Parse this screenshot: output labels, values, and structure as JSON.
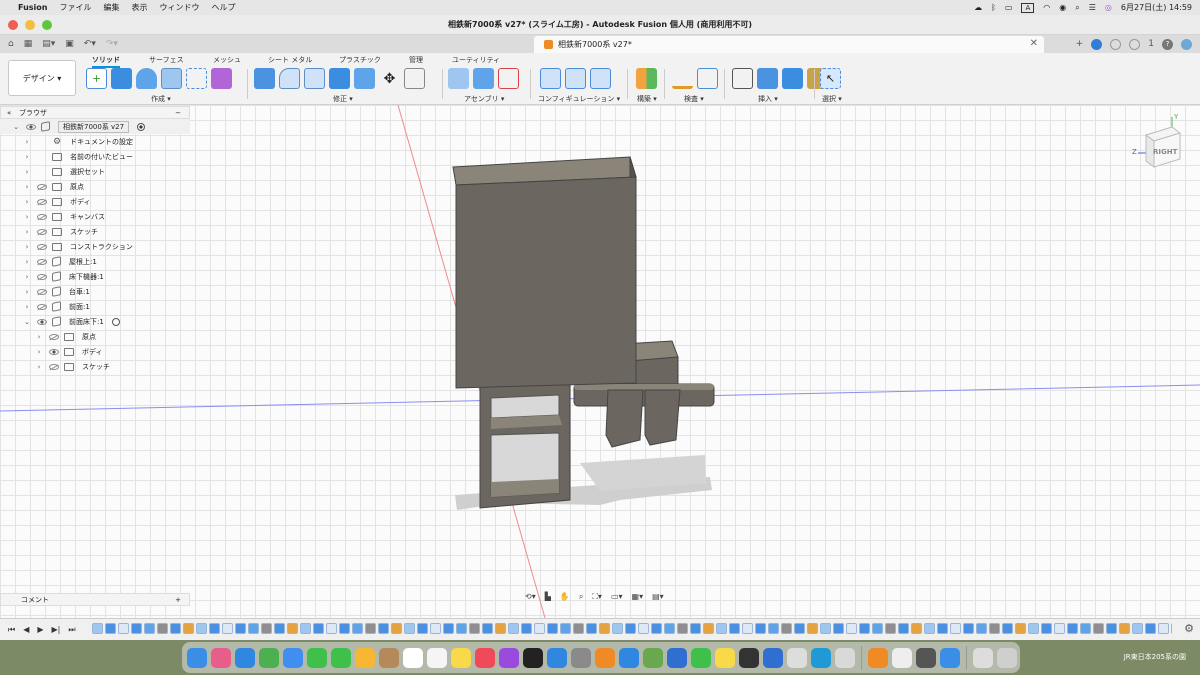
{
  "menubar": {
    "app_name": "Fusion",
    "items": [
      "ファイル",
      "編集",
      "表示",
      "ウィンドウ",
      "ヘルプ"
    ],
    "datetime": "6月27日(土) 14:59",
    "input_indicator": "A"
  },
  "window": {
    "title": "相鉄新7000系 v27* (スライム工房) - Autodesk Fusion 個人用 (商用利用不可)"
  },
  "document_tab": {
    "label": "相鉄新7000系 v27*",
    "close": "✕",
    "notifications": "1"
  },
  "toolbar": {
    "workspace": "デザイン ▾",
    "tabs": [
      "ソリッド",
      "サーフェス",
      "メッシュ",
      "シート メタル",
      "プラスチック",
      "管理",
      "ユーティリティ"
    ],
    "active_tab": "ソリッド",
    "groups": [
      {
        "label": "作成 ▾"
      },
      {
        "label": "修正 ▾"
      },
      {
        "label": "アセンブリ ▾"
      },
      {
        "label": "コンフィギュレーション ▾"
      },
      {
        "label": "構築 ▾"
      },
      {
        "label": "検査 ▾"
      },
      {
        "label": "挿入 ▾"
      },
      {
        "label": "選択 ▾"
      }
    ]
  },
  "browser": {
    "title": "ブラウザ",
    "rows": [
      {
        "label": "相鉄新7000系 v27",
        "expanded": true,
        "eye": "on",
        "icon": "doc",
        "indent": 0,
        "radio": true
      },
      {
        "label": "ドキュメントの設定",
        "expanded": false,
        "eye": "",
        "icon": "gear",
        "indent": 1
      },
      {
        "label": "名前の付いたビュー",
        "expanded": false,
        "eye": "",
        "icon": "folder",
        "indent": 1
      },
      {
        "label": "選択セット",
        "expanded": false,
        "eye": "",
        "icon": "folder",
        "indent": 1
      },
      {
        "label": "原点",
        "expanded": false,
        "eye": "off",
        "icon": "folder",
        "indent": 1
      },
      {
        "label": "ボディ",
        "expanded": false,
        "eye": "off",
        "icon": "folder",
        "indent": 1
      },
      {
        "label": "キャンバス",
        "expanded": false,
        "eye": "off",
        "icon": "folder",
        "indent": 1
      },
      {
        "label": "スケッチ",
        "expanded": false,
        "eye": "off",
        "icon": "folder",
        "indent": 1
      },
      {
        "label": "コンストラクション",
        "expanded": false,
        "eye": "off",
        "icon": "folder",
        "indent": 1
      },
      {
        "label": "屋根上:1",
        "expanded": false,
        "eye": "off",
        "icon": "component",
        "indent": 1
      },
      {
        "label": "床下機器:1",
        "expanded": false,
        "eye": "off",
        "icon": "component",
        "indent": 1
      },
      {
        "label": "台車:1",
        "expanded": false,
        "eye": "off",
        "icon": "component",
        "indent": 1
      },
      {
        "label": "前面:1",
        "expanded": false,
        "eye": "off",
        "icon": "component",
        "indent": 1
      },
      {
        "label": "前面床下:1",
        "expanded": true,
        "eye": "on",
        "icon": "component",
        "indent": 1,
        "radio": true
      },
      {
        "label": "原点",
        "expanded": false,
        "eye": "off",
        "icon": "folder",
        "indent": 2
      },
      {
        "label": "ボディ",
        "expanded": false,
        "eye": "on",
        "icon": "folder",
        "indent": 2
      },
      {
        "label": "スケッチ",
        "expanded": false,
        "eye": "off",
        "icon": "folder",
        "indent": 2
      }
    ]
  },
  "comments": {
    "label": "コメント",
    "add": "+"
  },
  "viewcube": {
    "face_label": "RIGHT",
    "axis_z": "Z",
    "axis_y": "Y"
  },
  "timeline": {
    "controls": [
      "⏮",
      "◀",
      "▶",
      "▶|",
      "⏭"
    ]
  },
  "dock": {
    "desktop_label": "JR東日本205系の園"
  },
  "colors": {
    "accent": "#0696d7",
    "model_body": "#6b665f",
    "model_top": "#8a8479",
    "model_side": "#56524c",
    "dock_bg": "#7d8a66"
  }
}
